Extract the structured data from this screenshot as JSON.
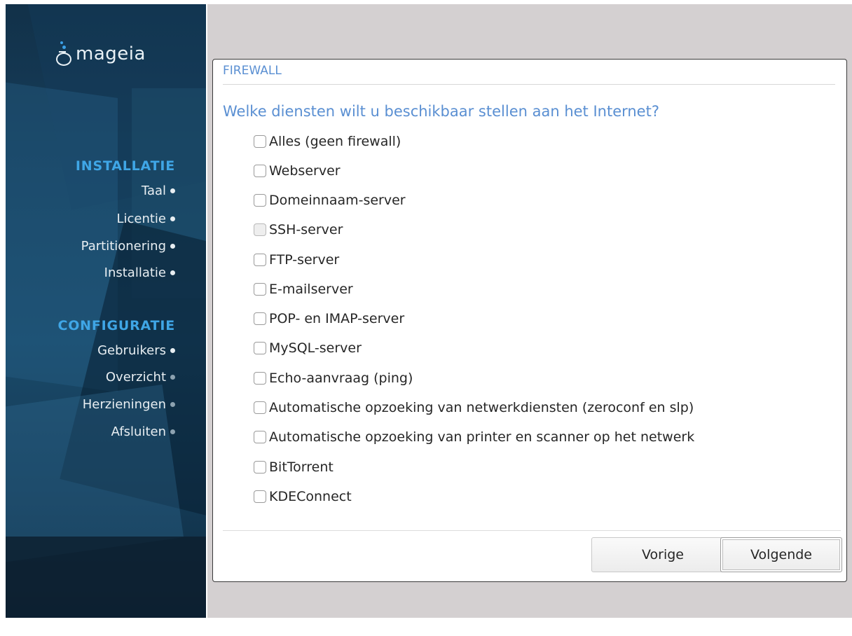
{
  "app": {
    "logo_text": "mageia"
  },
  "sidebar": {
    "sections": [
      {
        "heading": "INSTALLATIE",
        "items": [
          {
            "label": "Taal",
            "done": true
          },
          {
            "label": "Licentie",
            "done": true
          },
          {
            "label": "Partitionering",
            "done": true
          },
          {
            "label": "Installatie",
            "done": true
          }
        ]
      },
      {
        "heading": "CONFIGURATIE",
        "items": [
          {
            "label": "Gebruikers",
            "done": true
          },
          {
            "label": "Overzicht",
            "done": false
          },
          {
            "label": "Herzieningen",
            "done": false
          },
          {
            "label": "Afsluiten",
            "done": false
          }
        ]
      }
    ]
  },
  "dialog": {
    "title": "FIREWALL",
    "question": "Welke diensten wilt u beschikbaar stellen aan het Internet?",
    "options": [
      {
        "label": "Alles (geen firewall)",
        "checked": false
      },
      {
        "label": "Webserver",
        "checked": false
      },
      {
        "label": "Domeinnaam-server",
        "checked": false
      },
      {
        "label": "SSH-server",
        "checked": false
      },
      {
        "label": "FTP-server",
        "checked": false
      },
      {
        "label": "E-mailserver",
        "checked": false
      },
      {
        "label": "POP- en IMAP-server",
        "checked": false
      },
      {
        "label": "MySQL-server",
        "checked": false
      },
      {
        "label": "Echo-aanvraag (ping)",
        "checked": false
      },
      {
        "label": "Automatische opzoeking van netwerkdiensten (zeroconf en slp)",
        "checked": false
      },
      {
        "label": "Automatische opzoeking van printer en scanner op het netwerk",
        "checked": false
      },
      {
        "label": "BitTorrent",
        "checked": false
      },
      {
        "label": "KDEConnect",
        "checked": false
      }
    ],
    "buttons": {
      "previous": "Vorige",
      "next": "Volgende"
    }
  },
  "colors": {
    "accent_heading": "#3fa6e6",
    "dialog_text_blue": "#5a8fd2",
    "sidebar_bg": "#16405e",
    "frame_bg": "#d4d0d1"
  }
}
